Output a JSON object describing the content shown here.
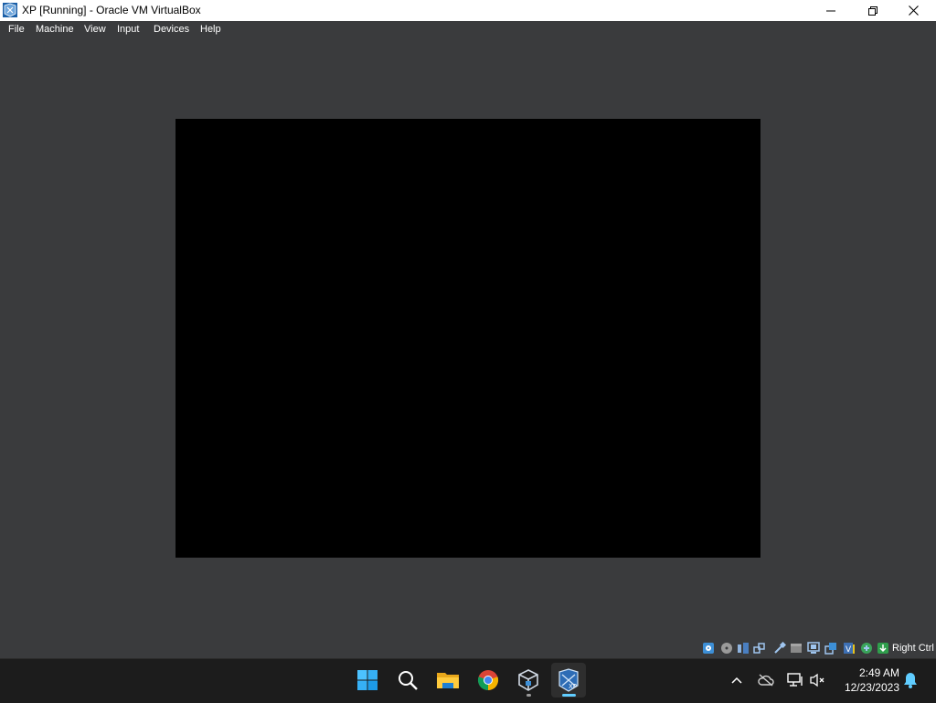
{
  "window": {
    "title": "XP [Running] - Oracle VM VirtualBox",
    "app_icon": "virtualbox-xp-icon",
    "controls": [
      "minimize-icon",
      "maximize-icon",
      "close-icon"
    ]
  },
  "menubar": {
    "items": [
      {
        "label": "File"
      },
      {
        "label": "Machine"
      },
      {
        "label": "View"
      },
      {
        "label": "Input"
      },
      {
        "label": "Devices"
      },
      {
        "label": "Help"
      }
    ]
  },
  "vm_display": {
    "state": "black screen",
    "background": "#000000"
  },
  "statusbar": {
    "icons": [
      "hard-disk-icon",
      "optical-drive-icon",
      "audio-icon",
      "network-icon",
      "usb-icon",
      "shared-folders-icon",
      "display-icon",
      "recording-icon",
      "cpu-icon",
      "mouse-integration-icon",
      "keyboard-icon"
    ],
    "host_key": "Right Ctrl"
  },
  "taskbar": {
    "apps": [
      {
        "name": "start-button",
        "icon": "windows-start-icon"
      },
      {
        "name": "search-button",
        "icon": "search-icon"
      },
      {
        "name": "file-explorer-button",
        "icon": "folder-icon"
      },
      {
        "name": "chrome-button",
        "icon": "chrome-icon"
      },
      {
        "name": "virtualbox-manager-button",
        "icon": "virtualbox-icon"
      },
      {
        "name": "xp-vm-button",
        "icon": "virtualbox-xp-icon",
        "active": true
      }
    ],
    "tray": {
      "icons": [
        "chevron-up-icon",
        "onedrive-offline-icon",
        "network-icon",
        "volume-muted-icon",
        "notification-bell-icon"
      ],
      "time": "2:49 AM",
      "date": "12/23/2023"
    }
  },
  "colors": {
    "window_bg": "#3a3b3d",
    "titlebar_bg": "#ffffff",
    "taskbar_bg": "#1c1c1c",
    "accent": "#60cdff"
  }
}
